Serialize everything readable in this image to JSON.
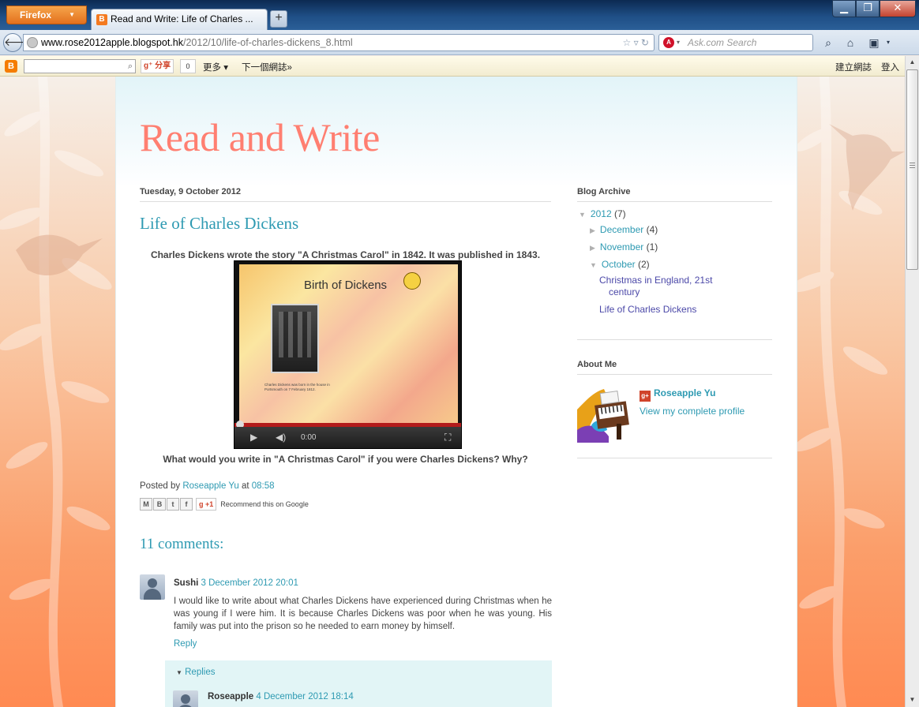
{
  "browser": {
    "menu_button": "Firefox",
    "tab_title": "Read and Write: Life of Charles ...",
    "new_tab": "+",
    "url_host": "www.rose2012apple.blogspot.hk",
    "url_path": "/2012/10/life-of-charles-dickens_8.html",
    "search_placeholder": "Ask.com Search"
  },
  "blogger_bar": {
    "share_label": "分享",
    "share_count": "0",
    "more": "更多 ▾",
    "next_blog": "下一個網誌»",
    "create_blog": "建立網誌",
    "sign_in": "登入"
  },
  "blog": {
    "title": "Read and Write"
  },
  "post": {
    "date": "Tuesday, 9 October 2012",
    "title": "Life of Charles Dickens",
    "intro": "Charles Dickens wrote the story \"A Christmas Carol\" in 1842. It was published in 1843.",
    "video": {
      "slide_title": "Birth of Dickens",
      "slide_caption": "Charles Dickens was born in the house in Portsmouth on 7 February 1812.",
      "time": "0:00"
    },
    "question": "What would you write in \"A Christmas Carol\" if you were Charles Dickens? Why?",
    "posted_by_label": "Posted by",
    "author": "Roseapple Yu",
    "at_label": "at",
    "time": "08:58",
    "share_icons": [
      "M",
      "B",
      "t",
      "f"
    ],
    "plus_one": "+1",
    "recommend": "Recommend this on Google"
  },
  "comments": {
    "title": "11 comments:",
    "items": [
      {
        "author": "Sushi",
        "date": "3 December 2012 20:01",
        "body": "I would like to write about what Charles Dickens have experienced during Christmas when he was young if I were him. It is because Charles Dickens was poor when he was young. His family was put into the prison so he needed to earn money by himself.",
        "reply": "Reply"
      }
    ],
    "replies_label": "Replies",
    "reply_author": "Roseapple",
    "reply_date": "4 December 2012 18:14"
  },
  "sidebar": {
    "archive_title": "Blog Archive",
    "year": {
      "label": "2012",
      "count": "(7)"
    },
    "months": [
      {
        "label": "December",
        "count": "(4)"
      },
      {
        "label": "November",
        "count": "(1)"
      },
      {
        "label": "October",
        "count": "(2)"
      }
    ],
    "october_posts": [
      "Christmas in England, 21st century",
      "Life of Charles Dickens"
    ],
    "about_title": "About Me",
    "profile_name": "Roseapple Yu",
    "profile_link": "View my complete profile"
  },
  "colors": {
    "title": "#ff7f71",
    "link": "#2e9ab2",
    "post_link": "#4b48a8",
    "background_bottom": "#ff8a52"
  }
}
